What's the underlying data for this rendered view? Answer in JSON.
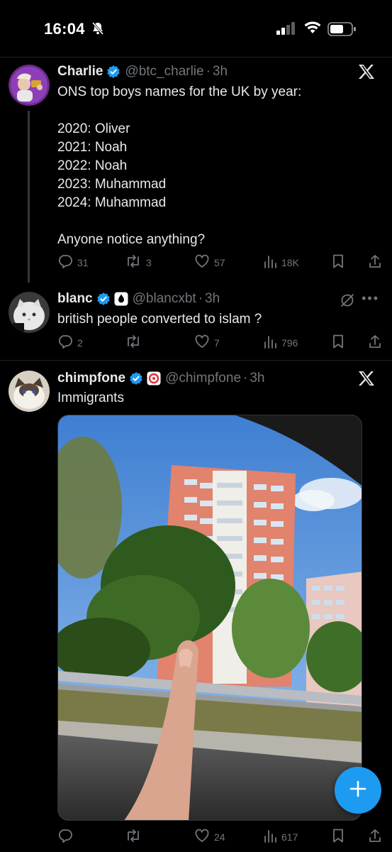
{
  "status_bar": {
    "time": "16:04"
  },
  "tweets": [
    {
      "name": "Charlie",
      "handle": "@btc_charlie",
      "separator": "·",
      "time_ago": "3h",
      "text": "ONS top boys names for the UK by year:\n\n2020: Oliver\n2021: Noah\n2022: Noah\n2023: Muhammad\n2024: Muhammad\n\nAnyone notice anything?",
      "replies": "31",
      "reposts": "3",
      "likes": "57",
      "views": "18K"
    },
    {
      "name": "blanc",
      "handle": "@blancxbt",
      "separator": "·",
      "time_ago": "3h",
      "text": "british people converted to islam ?",
      "replies": "2",
      "reposts": "",
      "likes": "7",
      "views": "796"
    },
    {
      "name": "chimpfone",
      "handle": "@chimpfone",
      "separator": "·",
      "time_ago": "3h",
      "text": "Immigrants",
      "replies": "",
      "reposts": "",
      "likes": "24",
      "views": "617"
    }
  ],
  "colors": {
    "background": "#000000",
    "accent": "#1d9bf0",
    "muted": "#71767b",
    "text": "#e7e9ea"
  },
  "icons": [
    "bell-slash-icon",
    "signal-icon",
    "wifi-icon",
    "battery-icon",
    "x-logo-icon",
    "verified-icon",
    "reply-icon",
    "repost-icon",
    "like-icon",
    "views-icon",
    "bookmark-icon",
    "share-icon",
    "more-icon",
    "grok-icon",
    "plus-icon"
  ]
}
